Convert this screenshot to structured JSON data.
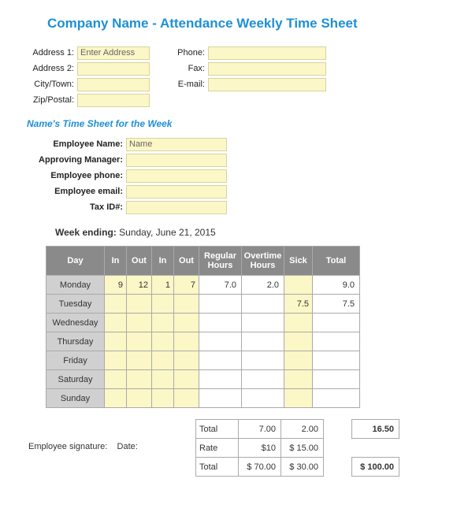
{
  "title": "Company Name - Attendance Weekly Time Sheet",
  "address": {
    "labels": {
      "addr1": "Address 1:",
      "addr2": "Address 2:",
      "city": "City/Town:",
      "zip": "Zip/Postal:",
      "phone": "Phone:",
      "fax": "Fax:",
      "email": "E-mail:"
    },
    "values": {
      "addr1": "Enter Address",
      "addr2": "",
      "city": "",
      "zip": "",
      "phone": "",
      "fax": "",
      "email": ""
    }
  },
  "subtitle": "Name's Time Sheet for the Week",
  "employee": {
    "labels": {
      "name": "Employee Name:",
      "manager": "Approving Manager:",
      "phone": "Employee phone:",
      "email": "Employee email:",
      "tax": "Tax ID#:"
    },
    "values": {
      "name": "Name",
      "manager": "",
      "phone": "",
      "email": "",
      "tax": ""
    }
  },
  "week_ending": {
    "label": "Week ending:",
    "value": "Sunday, June 21, 2015"
  },
  "table": {
    "headers": {
      "day": "Day",
      "in1": "In",
      "out1": "Out",
      "in2": "In",
      "out2": "Out",
      "reg": "Regular Hours",
      "ot": "Overtime Hours",
      "sick": "Sick",
      "total": "Total"
    },
    "rows": [
      {
        "day": "Monday",
        "in1": "9",
        "out1": "12",
        "in2": "1",
        "out2": "7",
        "reg": "7.0",
        "ot": "2.0",
        "sick": "",
        "total": "9.0"
      },
      {
        "day": "Tuesday",
        "in1": "",
        "out1": "",
        "in2": "",
        "out2": "",
        "reg": "",
        "ot": "",
        "sick": "7.5",
        "total": "7.5"
      },
      {
        "day": "Wednesday",
        "in1": "",
        "out1": "",
        "in2": "",
        "out2": "",
        "reg": "",
        "ot": "",
        "sick": "",
        "total": ""
      },
      {
        "day": "Thursday",
        "in1": "",
        "out1": "",
        "in2": "",
        "out2": "",
        "reg": "",
        "ot": "",
        "sick": "",
        "total": ""
      },
      {
        "day": "Friday",
        "in1": "",
        "out1": "",
        "in2": "",
        "out2": "",
        "reg": "",
        "ot": "",
        "sick": "",
        "total": ""
      },
      {
        "day": "Saturday",
        "in1": "",
        "out1": "",
        "in2": "",
        "out2": "",
        "reg": "",
        "ot": "",
        "sick": "",
        "total": ""
      },
      {
        "day": "Sunday",
        "in1": "",
        "out1": "",
        "in2": "",
        "out2": "",
        "reg": "",
        "ot": "",
        "sick": "",
        "total": ""
      }
    ]
  },
  "summary": {
    "total_label": "Total",
    "reg_total": "7.00",
    "ot_total": "2.00",
    "grand_total": "16.50",
    "rate_label": "Rate",
    "reg_rate": "$10",
    "ot_rate": "$    15.00",
    "pay_label": "Total",
    "reg_pay": "$  70.00",
    "ot_pay": "$    30.00",
    "grand_pay": "$  100.00"
  },
  "signature": {
    "sig": "Employee signature:",
    "date": "Date:"
  }
}
